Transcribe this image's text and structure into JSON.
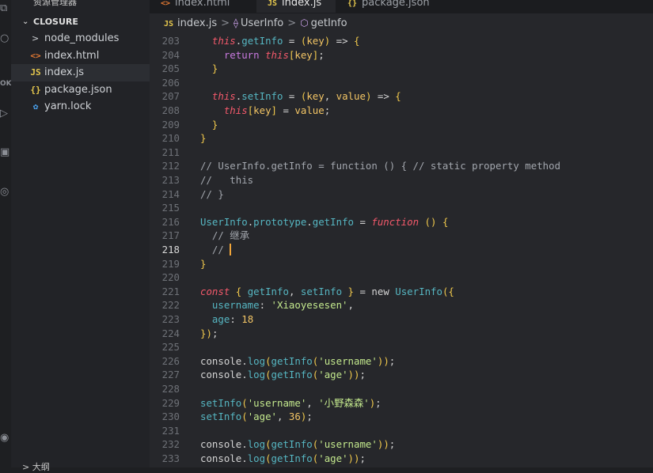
{
  "activity_bar": {
    "items": [
      "files-icon",
      "search-icon",
      "ok-badge",
      "run-debug-icon",
      "extensions-icon",
      "remote-icon",
      "account-icon"
    ],
    "ok_label": "OK"
  },
  "explorer": {
    "header": "资源管理器",
    "more": "···",
    "section": "CLOSURE",
    "items": [
      {
        "label": "node_modules",
        "icon": "chevron-right-icon",
        "glyph": ">",
        "color": "#cfd2d6"
      },
      {
        "label": "index.html",
        "icon": "html-icon",
        "glyph": "<>",
        "color": "#e37933"
      },
      {
        "label": "index.js",
        "icon": "js-icon",
        "glyph": "JS",
        "color": "#e6c84d"
      },
      {
        "label": "package.json",
        "icon": "json-icon",
        "glyph": "{}",
        "color": "#e6c84d"
      },
      {
        "label": "yarn.lock",
        "icon": "yarn-icon",
        "glyph": "✿",
        "color": "#4aa3f0"
      }
    ],
    "footer": "> 大纲"
  },
  "tabs": [
    {
      "label": "index.html",
      "glyph": "<>",
      "color": "#e37933",
      "active": false
    },
    {
      "label": "index.js",
      "glyph": "JS",
      "color": "#e6c84d",
      "active": true,
      "modified": true
    },
    {
      "label": "package.json",
      "glyph": "{}",
      "color": "#e6c84d",
      "active": false
    }
  ],
  "breadcrumb": {
    "file": "index.js",
    "file_glyph": "JS",
    "class": "UserInfo",
    "method": "getInfo"
  },
  "editor": {
    "current_line": 218,
    "lines": [
      {
        "n": 203,
        "t": "  this.getInfo = (key) => {"
      },
      {
        "n": 204,
        "t": "    return this[key];"
      },
      {
        "n": 205,
        "t": "  }"
      },
      {
        "n": 206,
        "t": ""
      },
      {
        "n": 207,
        "t": "  this.setInfo = (key, value) => {"
      },
      {
        "n": 208,
        "t": "    this[key] = value;"
      },
      {
        "n": 209,
        "t": "  }"
      },
      {
        "n": 210,
        "t": "}"
      },
      {
        "n": 211,
        "t": ""
      },
      {
        "n": 212,
        "t": "// UserInfo.getInfo = function () { // static property method"
      },
      {
        "n": 213,
        "t": "//   this"
      },
      {
        "n": 214,
        "t": "// }"
      },
      {
        "n": 215,
        "t": ""
      },
      {
        "n": 216,
        "t": "UserInfo.prototype.getInfo = function () {"
      },
      {
        "n": 217,
        "t": "  // 继承"
      },
      {
        "n": 218,
        "t": "  // "
      },
      {
        "n": 219,
        "t": "}"
      },
      {
        "n": 220,
        "t": ""
      },
      {
        "n": 221,
        "t": "const { getInfo, setInfo } = new UserInfo({"
      },
      {
        "n": 222,
        "t": "  username: 'Xiaoyesesen',"
      },
      {
        "n": 223,
        "t": "  age: 18"
      },
      {
        "n": 224,
        "t": "});"
      },
      {
        "n": 225,
        "t": ""
      },
      {
        "n": 226,
        "t": "console.log(getInfo('username'));"
      },
      {
        "n": 227,
        "t": "console.log(getInfo('age'));"
      },
      {
        "n": 228,
        "t": ""
      },
      {
        "n": 229,
        "t": "setInfo('username', '小野森森');"
      },
      {
        "n": 230,
        "t": "setInfo('age', 36);"
      },
      {
        "n": 231,
        "t": ""
      },
      {
        "n": 232,
        "t": "console.log(getInfo('username'));"
      },
      {
        "n": 233,
        "t": "console.log(getInfo('age'));"
      }
    ]
  }
}
